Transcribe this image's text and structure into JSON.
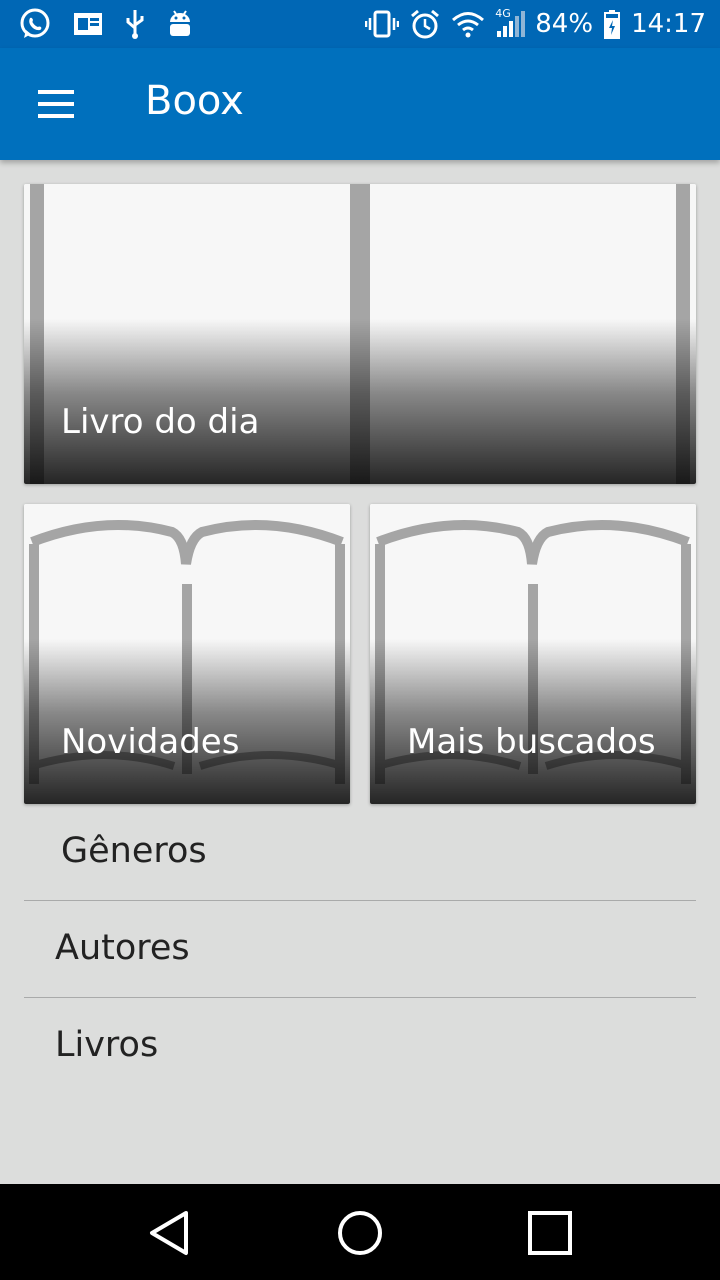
{
  "status_bar": {
    "battery_percent": "84%",
    "time": "14:17",
    "network_type": "4G",
    "icons_left": [
      "whatsapp-icon",
      "cast-message-icon",
      "usb-icon",
      "android-debug-icon"
    ],
    "icons_right": [
      "vibrate-icon",
      "alarm-icon",
      "wifi-icon",
      "signal-icon",
      "battery-charging-icon"
    ]
  },
  "app_bar": {
    "title": "Boox",
    "menu_icon": "hamburger-menu-icon",
    "color": "#0070bd"
  },
  "cards": {
    "book_of_day": {
      "label": "Livro do dia"
    },
    "new": {
      "label": "Novidades"
    },
    "most_searched": {
      "label": "Mais buscados"
    }
  },
  "list": {
    "items": [
      {
        "label": "Gêneros"
      },
      {
        "label": "Autores"
      },
      {
        "label": "Livros"
      }
    ]
  },
  "nav_bar": {
    "buttons": [
      "back-icon",
      "home-icon",
      "recents-icon"
    ]
  }
}
